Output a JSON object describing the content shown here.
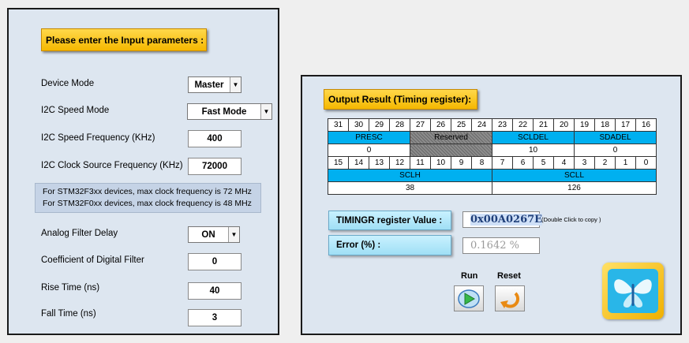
{
  "input": {
    "title": "Please enter the Input parameters :",
    "device_mode_label": "Device Mode",
    "device_mode_value": "Master",
    "speed_mode_label": "I2C Speed Mode",
    "speed_mode_value": "Fast Mode",
    "speed_freq_label": "I2C Speed Frequency (KHz)",
    "speed_freq_value": "400",
    "clock_source_label": "I2C Clock Source Frequency  (KHz)",
    "clock_source_value": "72000",
    "info_line1": "For STM32F3xx devices, max clock frequency is 72 MHz",
    "info_line2": "For STM32F0xx devices, max clock frequency is 48 MHz",
    "analog_filter_label": "Analog Filter Delay",
    "analog_filter_value": "ON",
    "digital_filter_label": "Coefficient of Digital Filter",
    "digital_filter_value": "0",
    "rise_time_label": "Rise Time (ns)",
    "rise_time_value": "40",
    "fall_time_label": "Fall Time (ns)",
    "fall_time_value": "3"
  },
  "output": {
    "title": "Output Result (Timing register):",
    "bits_high": [
      "31",
      "30",
      "29",
      "28",
      "27",
      "26",
      "25",
      "24",
      "23",
      "22",
      "21",
      "20",
      "19",
      "18",
      "17",
      "16"
    ],
    "fields_high": [
      {
        "name": "PRESC",
        "value": "0"
      },
      {
        "name": "Reserved",
        "value": ""
      },
      {
        "name": "SCLDEL",
        "value": "10"
      },
      {
        "name": "SDADEL",
        "value": "0"
      }
    ],
    "bits_low": [
      "15",
      "14",
      "13",
      "12",
      "11",
      "10",
      "9",
      "8",
      "7",
      "6",
      "5",
      "4",
      "3",
      "2",
      "1",
      "0"
    ],
    "fields_low": [
      {
        "name": "SCLH",
        "value": "38"
      },
      {
        "name": "SCLL",
        "value": "126"
      }
    ],
    "timingr_label": "TIMINGR register Value :",
    "timingr_value": "0x00A0267E",
    "copy_hint": "(Double Click to copy )",
    "error_label": "Error (%) :",
    "error_value": "0.1642 %",
    "run_label": "Run",
    "reset_label": "Reset"
  },
  "colors": {
    "panel_bg": "#dde6f0",
    "field_name_bg": "#00b0f0",
    "title_bg": "#ffc000"
  },
  "icons": {
    "run": "play-icon",
    "reset": "undo-arrow-icon",
    "logo": "stm32-butterfly-logo-icon"
  }
}
